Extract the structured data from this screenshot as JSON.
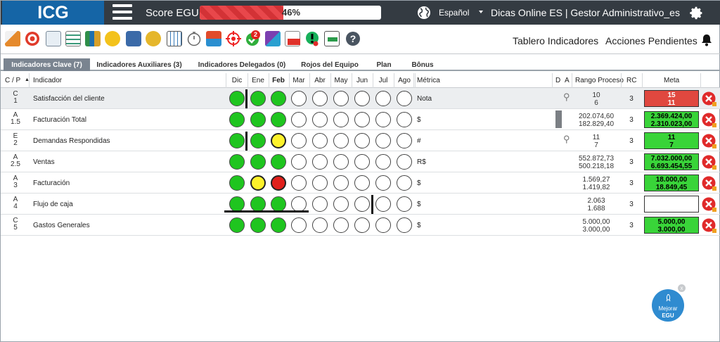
{
  "app": {
    "logo": "ICG",
    "score_label": "Score EGU:",
    "score_text": "46%",
    "score_value": 0.46
  },
  "header": {
    "language": "Español",
    "company": "Dicas Online ES  |  Gestor Administrativo_es"
  },
  "toolbar": {
    "tablero": "Tablero Indicadores",
    "acciones": "Acciones Pendientes",
    "badge": "2"
  },
  "tabs": [
    "Indicadores Clave (7)",
    "Indicadores Auxiliares (3)",
    "Indicadores Delegados (0)",
    "Rojos del Equipo",
    "Plan",
    "Bônus"
  ],
  "columns": {
    "cp": "C / P",
    "indicador": "Indicador",
    "months": [
      "Dic",
      "Ene",
      "Feb",
      "Mar",
      "Abr",
      "May",
      "Jun",
      "Jul",
      "Ago"
    ],
    "metrica": "Métrica",
    "d": "D",
    "a": "A",
    "rango": "Rango Proceso",
    "rc": "RC",
    "meta": "Meta"
  },
  "rows": [
    {
      "c": "C",
      "p": "1",
      "name": "Satisfacción del cliente",
      "metric": "Nota",
      "rango1": "10",
      "rango2": "6",
      "rc": "3",
      "meta1": "15",
      "meta2": "11",
      "meta_color": "red"
    },
    {
      "c": "A",
      "p": "1.5",
      "name": "Facturación Total",
      "metric": "$",
      "rango1": "202.074,60",
      "rango2": "182.829,40",
      "rc": "3",
      "meta1": "2.369.424,00",
      "meta2": "2.310.023,00",
      "meta_color": "green"
    },
    {
      "c": "E",
      "p": "2",
      "name": "Demandas Respondidas",
      "metric": "#",
      "rango1": "11",
      "rango2": "7",
      "rc": "3",
      "meta1": "11",
      "meta2": "7",
      "meta_color": "green"
    },
    {
      "c": "A",
      "p": "2.5",
      "name": "Ventas",
      "metric": "R$",
      "rango1": "552.872,73",
      "rango2": "500.218,18",
      "rc": "3",
      "meta1": "7.032.000,00",
      "meta2": "6.693.454,55",
      "meta_color": "green"
    },
    {
      "c": "A",
      "p": "3",
      "name": "Facturación",
      "metric": "$",
      "rango1": "1.569,27",
      "rango2": "1.419,82",
      "rc": "3",
      "meta1": "18.000,00",
      "meta2": "18.849,45",
      "meta_color": "green"
    },
    {
      "c": "A",
      "p": "4",
      "name": "Flujo de caja",
      "metric": "$",
      "rango1": "2.063",
      "rango2": "1.688",
      "rc": "3",
      "meta1": "",
      "meta2": "",
      "meta_color": "empty"
    },
    {
      "c": "C",
      "p": "5",
      "name": "Gastos Generales",
      "metric": "$",
      "rango1": "5.000,00",
      "rango2": "3.000,00",
      "rc": "3",
      "meta1": "5.000,00",
      "meta2": "3.000,00",
      "meta_color": "green"
    }
  ],
  "status_grid": [
    [
      "green",
      "green",
      "green",
      "empty",
      "empty",
      "empty",
      "empty",
      "empty",
      "empty"
    ],
    [
      "green",
      "green",
      "green",
      "empty",
      "empty",
      "empty",
      "empty",
      "empty",
      "empty"
    ],
    [
      "green",
      "green",
      "yellow",
      "empty",
      "empty",
      "empty",
      "empty",
      "empty",
      "empty"
    ],
    [
      "green",
      "green",
      "green",
      "empty",
      "empty",
      "empty",
      "empty",
      "empty",
      "empty"
    ],
    [
      "green",
      "yellow",
      "red",
      "empty",
      "empty",
      "empty",
      "empty",
      "empty",
      "empty"
    ],
    [
      "green",
      "green",
      "green",
      "empty",
      "empty",
      "empty",
      "empty",
      "empty",
      "empty"
    ],
    [
      "green",
      "green",
      "green",
      "empty",
      "empty",
      "empty",
      "empty",
      "empty",
      "empty"
    ]
  ],
  "fab": {
    "line1": "Mejorar",
    "line2": "EGU",
    "close": "x"
  },
  "colors": {
    "topbar": "#343b42",
    "logo": "#1565a6",
    "green": "#1fc51f",
    "red": "#e0201b",
    "yellow": "#fdf22a"
  }
}
